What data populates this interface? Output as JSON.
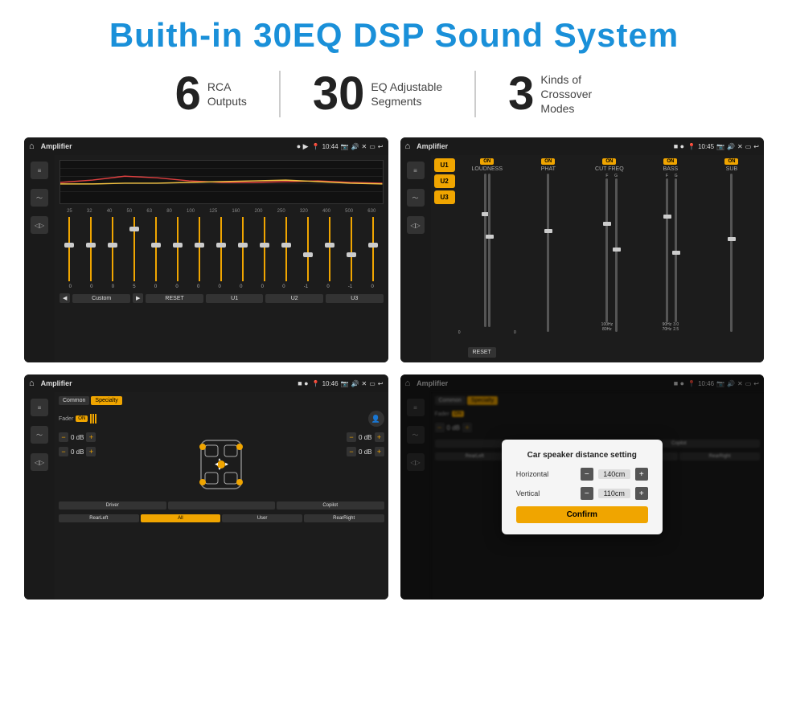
{
  "page": {
    "title": "Buith-in 30EQ DSP Sound System"
  },
  "stats": [
    {
      "number": "6",
      "label": "RCA\nOutputs"
    },
    {
      "number": "30",
      "label": "EQ Adjustable\nSegments"
    },
    {
      "number": "3",
      "label": "Kinds of\nCrossover Modes"
    }
  ],
  "screens": [
    {
      "id": "eq-screen",
      "statusBar": {
        "appName": "Amplifier",
        "time": "10:44"
      },
      "type": "eq"
    },
    {
      "id": "crossover-screen",
      "statusBar": {
        "appName": "Amplifier",
        "time": "10:45"
      },
      "type": "crossover"
    },
    {
      "id": "speaker-screen",
      "statusBar": {
        "appName": "Amplifier",
        "time": "10:46"
      },
      "type": "speaker"
    },
    {
      "id": "distance-screen",
      "statusBar": {
        "appName": "Amplifier",
        "time": "10:46"
      },
      "type": "distance",
      "dialog": {
        "title": "Car speaker distance setting",
        "horizontal": {
          "label": "Horizontal",
          "value": "140cm"
        },
        "vertical": {
          "label": "Vertical",
          "value": "110cm"
        },
        "confirmLabel": "Confirm"
      }
    }
  ],
  "eq": {
    "frequencies": [
      "25",
      "32",
      "40",
      "50",
      "63",
      "80",
      "100",
      "125",
      "160",
      "200",
      "250",
      "320",
      "400",
      "500",
      "630"
    ],
    "values": [
      "0",
      "0",
      "0",
      "5",
      "0",
      "0",
      "0",
      "0",
      "0",
      "0",
      "0",
      "-1",
      "0",
      "-1"
    ],
    "presets": [
      "Custom",
      "RESET",
      "U1",
      "U2",
      "U3"
    ]
  },
  "crossover": {
    "presets": [
      "U1",
      "U2",
      "U3"
    ],
    "channels": [
      {
        "label": "LOUDNESS",
        "on": true
      },
      {
        "label": "PHAT",
        "on": true
      },
      {
        "label": "CUT FREQ",
        "on": true
      },
      {
        "label": "BASS",
        "on": true
      },
      {
        "label": "SUB",
        "on": true
      }
    ],
    "resetLabel": "RESET"
  },
  "speaker": {
    "tabs": [
      "Common",
      "Specialty"
    ],
    "activeTab": "Specialty",
    "faderLabel": "Fader",
    "on": "ON",
    "volumes": [
      {
        "value": "0 dB"
      },
      {
        "value": "0 dB"
      },
      {
        "value": "0 dB"
      },
      {
        "value": "0 dB"
      }
    ],
    "navButtons": [
      "Driver",
      "",
      "Copilot",
      "RearLeft",
      "All",
      "User",
      "RearRight"
    ]
  },
  "distance": {
    "tabs": [
      "Common",
      "Specialty"
    ],
    "horizontal": "140cm",
    "vertical": "110cm",
    "confirmLabel": "Confirm",
    "dialogTitle": "Car speaker distance setting"
  }
}
